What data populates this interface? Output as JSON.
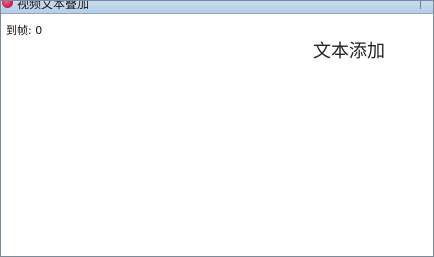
{
  "window": {
    "title": "视频文本叠加"
  },
  "content": {
    "frame_label": "到帧: 0",
    "overlay_text": "文本添加"
  },
  "colors": {
    "titlebar": "#b6cde8",
    "border": "#7a8a99",
    "app_icon": "#d02050"
  },
  "icons": {
    "app_icon": "app-icon"
  }
}
